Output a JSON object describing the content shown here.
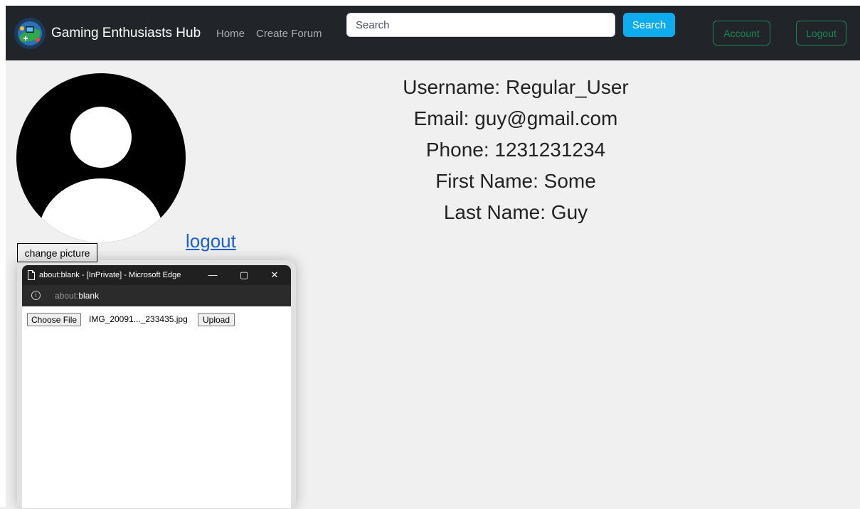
{
  "navbar": {
    "brand": "Gaming Enthusiasts Hub",
    "links": [
      "Home",
      "Create Forum"
    ],
    "search_placeholder": "Search",
    "search_button": "Search",
    "account_button": "Account",
    "logout_button": "Logout"
  },
  "profile": {
    "change_picture_button": "change picture",
    "logout_link": "logout",
    "info": [
      "Username: Regular_User",
      "Email: guy@gmail.com",
      "Phone: 1231231234",
      "First Name: Some",
      "Last Name: Guy"
    ]
  },
  "popup": {
    "title": "about:blank - [InPrivate] - Microsoft Edge",
    "address_prefix": "about:",
    "address_host": "blank",
    "choose_file_button": "Choose File",
    "file_name": "IMG_20091..._233435.jpg",
    "upload_button": "Upload",
    "controls": {
      "minimize": "—",
      "maximize": "▢",
      "close": "✕"
    }
  },
  "colors": {
    "navbar_bg": "#212529",
    "search_button_bg": "#0dacef",
    "outline_green": "#198754",
    "link_blue": "#1a5fd8"
  }
}
